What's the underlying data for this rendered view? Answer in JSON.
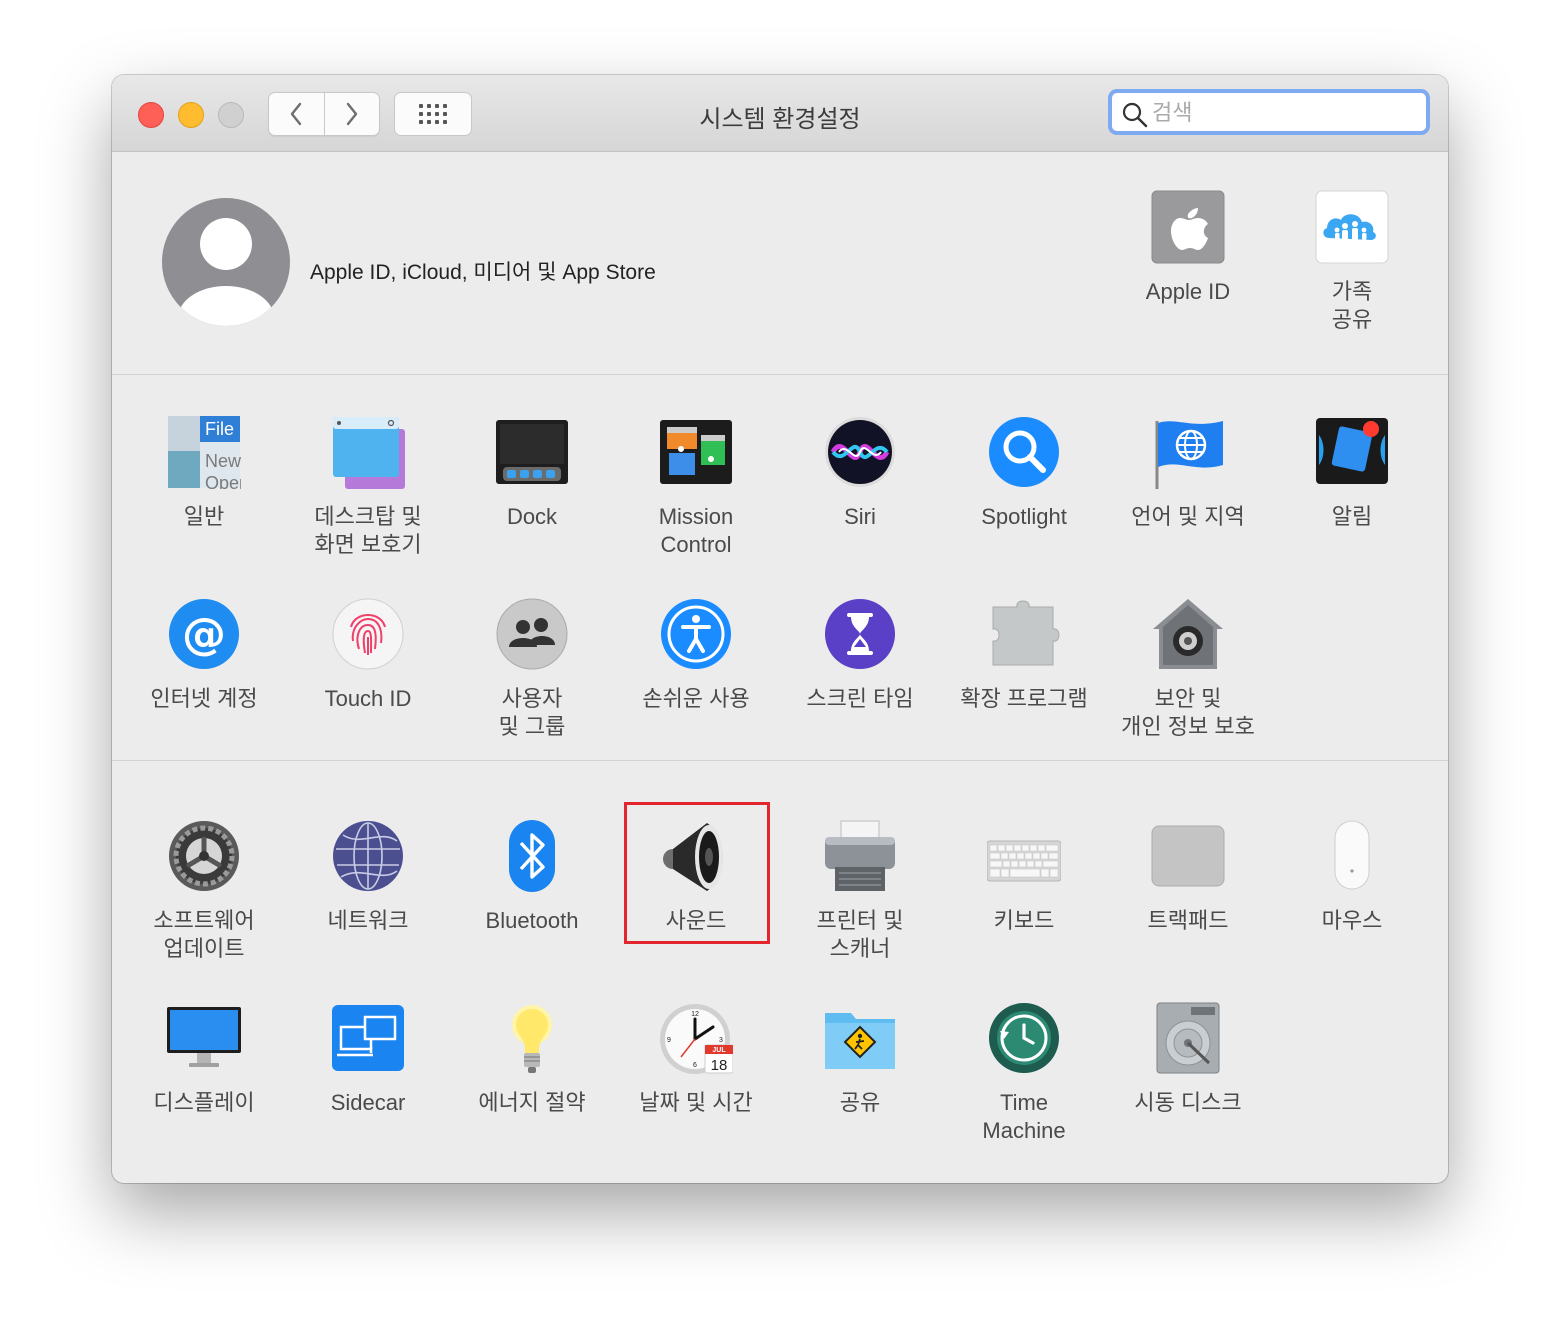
{
  "window": {
    "title": "시스템 환경설정"
  },
  "search": {
    "placeholder": "검색",
    "value": ""
  },
  "account": {
    "label": "Apple ID, iCloud, 미디어 및 App Store"
  },
  "top_panes": [
    {
      "id": "apple-id",
      "label": "Apple ID",
      "icon": "apple-logo-icon"
    },
    {
      "id": "family",
      "label": "가족\n공유",
      "icon": "family-sharing-icon"
    }
  ],
  "panes_row1": [
    {
      "id": "general",
      "label": "일반",
      "icon": "general-icon"
    },
    {
      "id": "desktop",
      "label": "데스크탑 및\n화면 보호기",
      "icon": "desktop-screensaver-icon"
    },
    {
      "id": "dock",
      "label": "Dock",
      "icon": "dock-icon"
    },
    {
      "id": "mission-control",
      "label": "Mission\nControl",
      "icon": "mission-control-icon"
    },
    {
      "id": "siri",
      "label": "Siri",
      "icon": "siri-icon"
    },
    {
      "id": "spotlight",
      "label": "Spotlight",
      "icon": "spotlight-icon"
    },
    {
      "id": "language",
      "label": "언어 및 지역",
      "icon": "language-region-icon"
    },
    {
      "id": "notifications",
      "label": "알림",
      "icon": "notifications-icon"
    }
  ],
  "panes_row2": [
    {
      "id": "internet-accounts",
      "label": "인터넷 계정",
      "icon": "internet-accounts-icon"
    },
    {
      "id": "touch-id",
      "label": "Touch ID",
      "icon": "touch-id-icon"
    },
    {
      "id": "users",
      "label": "사용자\n및 그룹",
      "icon": "users-groups-icon"
    },
    {
      "id": "accessibility",
      "label": "손쉬운 사용",
      "icon": "accessibility-icon"
    },
    {
      "id": "screen-time",
      "label": "스크린 타임",
      "icon": "screen-time-icon"
    },
    {
      "id": "extensions",
      "label": "확장 프로그램",
      "icon": "extensions-icon"
    },
    {
      "id": "security",
      "label": "보안 및\n개인 정보 보호",
      "icon": "security-privacy-icon"
    }
  ],
  "panes_row3": [
    {
      "id": "software-update",
      "label": "소프트웨어\n업데이트",
      "icon": "software-update-icon"
    },
    {
      "id": "network",
      "label": "네트워크",
      "icon": "network-icon"
    },
    {
      "id": "bluetooth",
      "label": "Bluetooth",
      "icon": "bluetooth-icon"
    },
    {
      "id": "sound",
      "label": "사운드",
      "icon": "sound-icon",
      "highlighted": true
    },
    {
      "id": "printers",
      "label": "프린터 및\n스캐너",
      "icon": "printers-scanners-icon"
    },
    {
      "id": "keyboard",
      "label": "키보드",
      "icon": "keyboard-icon"
    },
    {
      "id": "trackpad",
      "label": "트랙패드",
      "icon": "trackpad-icon"
    },
    {
      "id": "mouse",
      "label": "마우스",
      "icon": "mouse-icon"
    }
  ],
  "panes_row4": [
    {
      "id": "displays",
      "label": "디스플레이",
      "icon": "displays-icon"
    },
    {
      "id": "sidecar",
      "label": "Sidecar",
      "icon": "sidecar-icon"
    },
    {
      "id": "energy",
      "label": "에너지 절약",
      "icon": "energy-saver-icon"
    },
    {
      "id": "date-time",
      "label": "날짜 및 시간",
      "icon": "date-time-icon",
      "calendar_month": "JUL",
      "calendar_day": "18"
    },
    {
      "id": "sharing",
      "label": "공유",
      "icon": "sharing-icon"
    },
    {
      "id": "time-machine",
      "label": "Time\nMachine",
      "icon": "time-machine-icon"
    },
    {
      "id": "startup-disk",
      "label": "시동 디스크",
      "icon": "startup-disk-icon"
    }
  ],
  "general_icon_text": {
    "file": "File",
    "new": "New",
    "open": "Open"
  },
  "colors": {
    "highlight": "#e3262e",
    "search_focus": "#7faaf2",
    "accent_blue": "#1a8cff"
  }
}
